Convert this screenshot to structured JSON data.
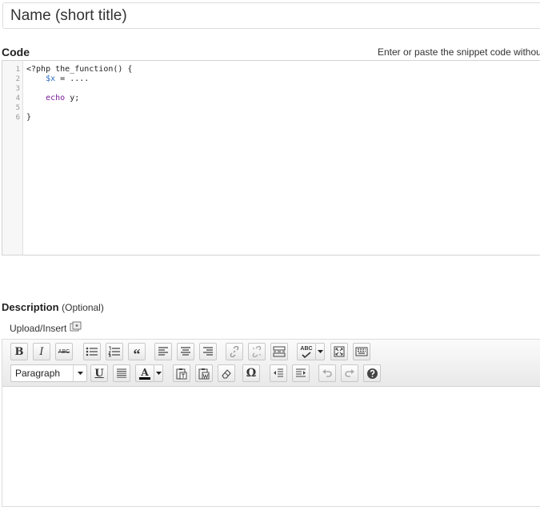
{
  "title_field": {
    "value": "Name (short title)"
  },
  "code": {
    "label": "Code",
    "hint": "Enter or paste the snippet code withou",
    "line_numbers": [
      "1",
      "2",
      "3",
      "4",
      "5",
      "6"
    ],
    "lines": [
      [
        {
          "t": "<?php the_function() {",
          "c": "plain"
        }
      ],
      [
        {
          "t": "    ",
          "c": "plain"
        },
        {
          "t": "$x",
          "c": "var"
        },
        {
          "t": " = ....",
          "c": "plain"
        }
      ],
      [
        {
          "t": "",
          "c": "plain"
        }
      ],
      [
        {
          "t": "    ",
          "c": "plain"
        },
        {
          "t": "echo",
          "c": "kw"
        },
        {
          "t": " y;",
          "c": "plain"
        }
      ],
      [
        {
          "t": "",
          "c": "plain"
        }
      ],
      [
        {
          "t": "}",
          "c": "plain"
        }
      ]
    ]
  },
  "description": {
    "label": "Description",
    "optional": "(Optional)",
    "upload_label": "Upload/Insert"
  },
  "toolbar": {
    "paragraph_select": "Paragraph",
    "bold": "B",
    "italic": "I",
    "strike": "ABC",
    "underline": "U",
    "text_color": "A",
    "omega": "Ω",
    "spell": "ABC"
  }
}
